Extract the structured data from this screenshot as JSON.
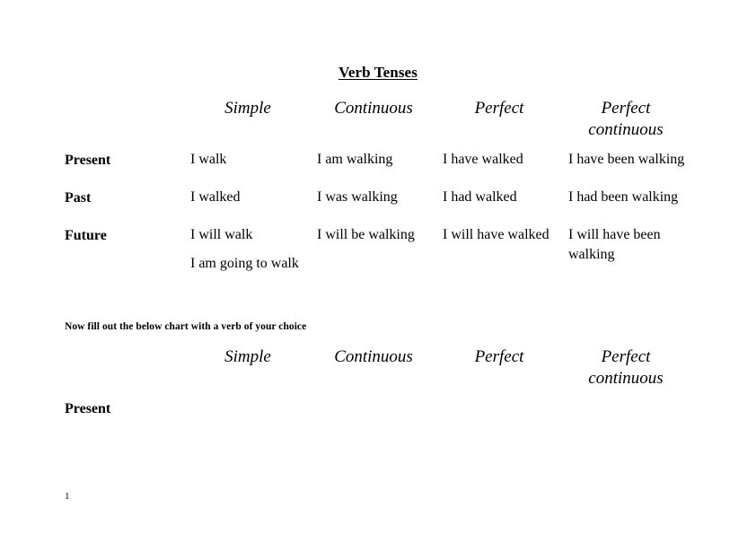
{
  "document": {
    "title": "Verb Tenses",
    "page_number": "1",
    "instruction": "Now fill out the below chart with a verb of your choice"
  },
  "tables": [
    {
      "id": "verb-tenses",
      "columns": [
        "Simple",
        "Continuous",
        "Perfect",
        "Perfect continuous"
      ],
      "rows": [
        {
          "label": "Present",
          "cells": [
            {
              "primary": "I walk",
              "alternate": ""
            },
            {
              "primary": "I am walking",
              "alternate": ""
            },
            {
              "primary": "I have walked",
              "alternate": ""
            },
            {
              "primary": "I have been walking",
              "alternate": ""
            }
          ]
        },
        {
          "label": "Past",
          "cells": [
            {
              "primary": "I walked",
              "alternate": ""
            },
            {
              "primary": "I was walking",
              "alternate": ""
            },
            {
              "primary": "I had walked",
              "alternate": ""
            },
            {
              "primary": "I had been walking",
              "alternate": ""
            }
          ]
        },
        {
          "label": "Future",
          "cells": [
            {
              "primary": "I will walk",
              "alternate": "I am going to walk"
            },
            {
              "primary": "I will be walking",
              "alternate": ""
            },
            {
              "primary": "I will have walked",
              "alternate": ""
            },
            {
              "primary": "I will have been walking",
              "alternate": ""
            }
          ]
        }
      ]
    },
    {
      "id": "blank",
      "columns": [
        "Simple",
        "Continuous",
        "Perfect",
        "Perfect continuous"
      ],
      "rows": [
        {
          "label": "Present",
          "cells": [
            {
              "primary": "",
              "alternate": ""
            },
            {
              "primary": "",
              "alternate": ""
            },
            {
              "primary": "",
              "alternate": ""
            },
            {
              "primary": "",
              "alternate": ""
            }
          ]
        }
      ]
    }
  ]
}
